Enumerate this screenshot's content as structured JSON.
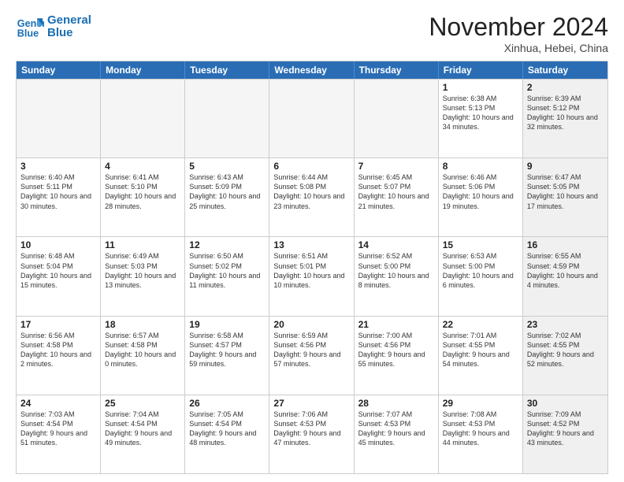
{
  "header": {
    "logo_line1": "General",
    "logo_line2": "Blue",
    "month": "November 2024",
    "location": "Xinhua, Hebei, China"
  },
  "weekdays": [
    "Sunday",
    "Monday",
    "Tuesday",
    "Wednesday",
    "Thursday",
    "Friday",
    "Saturday"
  ],
  "rows": [
    [
      {
        "day": "",
        "empty": true
      },
      {
        "day": "",
        "empty": true
      },
      {
        "day": "",
        "empty": true
      },
      {
        "day": "",
        "empty": true
      },
      {
        "day": "",
        "empty": true
      },
      {
        "day": "1",
        "sunrise": "6:38 AM",
        "sunset": "5:13 PM",
        "daylight": "10 hours and 34 minutes."
      },
      {
        "day": "2",
        "sunrise": "6:39 AM",
        "sunset": "5:12 PM",
        "daylight": "10 hours and 32 minutes.",
        "shaded": true
      }
    ],
    [
      {
        "day": "3",
        "sunrise": "6:40 AM",
        "sunset": "5:11 PM",
        "daylight": "10 hours and 30 minutes."
      },
      {
        "day": "4",
        "sunrise": "6:41 AM",
        "sunset": "5:10 PM",
        "daylight": "10 hours and 28 minutes."
      },
      {
        "day": "5",
        "sunrise": "6:43 AM",
        "sunset": "5:09 PM",
        "daylight": "10 hours and 25 minutes."
      },
      {
        "day": "6",
        "sunrise": "6:44 AM",
        "sunset": "5:08 PM",
        "daylight": "10 hours and 23 minutes."
      },
      {
        "day": "7",
        "sunrise": "6:45 AM",
        "sunset": "5:07 PM",
        "daylight": "10 hours and 21 minutes."
      },
      {
        "day": "8",
        "sunrise": "6:46 AM",
        "sunset": "5:06 PM",
        "daylight": "10 hours and 19 minutes."
      },
      {
        "day": "9",
        "sunrise": "6:47 AM",
        "sunset": "5:05 PM",
        "daylight": "10 hours and 17 minutes.",
        "shaded": true
      }
    ],
    [
      {
        "day": "10",
        "sunrise": "6:48 AM",
        "sunset": "5:04 PM",
        "daylight": "10 hours and 15 minutes."
      },
      {
        "day": "11",
        "sunrise": "6:49 AM",
        "sunset": "5:03 PM",
        "daylight": "10 hours and 13 minutes."
      },
      {
        "day": "12",
        "sunrise": "6:50 AM",
        "sunset": "5:02 PM",
        "daylight": "10 hours and 11 minutes."
      },
      {
        "day": "13",
        "sunrise": "6:51 AM",
        "sunset": "5:01 PM",
        "daylight": "10 hours and 10 minutes."
      },
      {
        "day": "14",
        "sunrise": "6:52 AM",
        "sunset": "5:00 PM",
        "daylight": "10 hours and 8 minutes."
      },
      {
        "day": "15",
        "sunrise": "6:53 AM",
        "sunset": "5:00 PM",
        "daylight": "10 hours and 6 minutes."
      },
      {
        "day": "16",
        "sunrise": "6:55 AM",
        "sunset": "4:59 PM",
        "daylight": "10 hours and 4 minutes.",
        "shaded": true
      }
    ],
    [
      {
        "day": "17",
        "sunrise": "6:56 AM",
        "sunset": "4:58 PM",
        "daylight": "10 hours and 2 minutes."
      },
      {
        "day": "18",
        "sunrise": "6:57 AM",
        "sunset": "4:58 PM",
        "daylight": "10 hours and 0 minutes."
      },
      {
        "day": "19",
        "sunrise": "6:58 AM",
        "sunset": "4:57 PM",
        "daylight": "9 hours and 59 minutes."
      },
      {
        "day": "20",
        "sunrise": "6:59 AM",
        "sunset": "4:56 PM",
        "daylight": "9 hours and 57 minutes."
      },
      {
        "day": "21",
        "sunrise": "7:00 AM",
        "sunset": "4:56 PM",
        "daylight": "9 hours and 55 minutes."
      },
      {
        "day": "22",
        "sunrise": "7:01 AM",
        "sunset": "4:55 PM",
        "daylight": "9 hours and 54 minutes."
      },
      {
        "day": "23",
        "sunrise": "7:02 AM",
        "sunset": "4:55 PM",
        "daylight": "9 hours and 52 minutes.",
        "shaded": true
      }
    ],
    [
      {
        "day": "24",
        "sunrise": "7:03 AM",
        "sunset": "4:54 PM",
        "daylight": "9 hours and 51 minutes."
      },
      {
        "day": "25",
        "sunrise": "7:04 AM",
        "sunset": "4:54 PM",
        "daylight": "9 hours and 49 minutes."
      },
      {
        "day": "26",
        "sunrise": "7:05 AM",
        "sunset": "4:54 PM",
        "daylight": "9 hours and 48 minutes."
      },
      {
        "day": "27",
        "sunrise": "7:06 AM",
        "sunset": "4:53 PM",
        "daylight": "9 hours and 47 minutes."
      },
      {
        "day": "28",
        "sunrise": "7:07 AM",
        "sunset": "4:53 PM",
        "daylight": "9 hours and 45 minutes."
      },
      {
        "day": "29",
        "sunrise": "7:08 AM",
        "sunset": "4:53 PM",
        "daylight": "9 hours and 44 minutes."
      },
      {
        "day": "30",
        "sunrise": "7:09 AM",
        "sunset": "4:52 PM",
        "daylight": "9 hours and 43 minutes.",
        "shaded": true
      }
    ]
  ]
}
